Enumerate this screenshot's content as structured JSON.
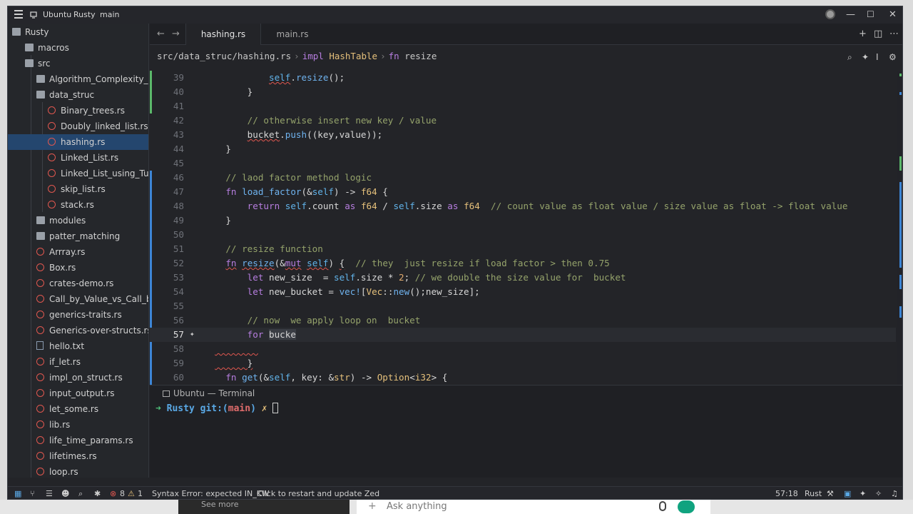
{
  "titlebar": {
    "menu_icon": "hamburger-icon",
    "host": "Ubuntu",
    "project": "Rusty",
    "branch": "main"
  },
  "sidebar": {
    "items": [
      {
        "label": "Rusty",
        "type": "folder",
        "depth": 0
      },
      {
        "label": "macros",
        "type": "folder",
        "depth": 1
      },
      {
        "label": "src",
        "type": "folder",
        "depth": 1
      },
      {
        "label": "Algorithm_Complexity_Sol",
        "type": "folder",
        "depth": 2
      },
      {
        "label": "data_struc",
        "type": "folder",
        "depth": 2
      },
      {
        "label": "Binary_trees.rs",
        "type": "rust",
        "depth": 3
      },
      {
        "label": "Doubly_linked_list.rs",
        "type": "rust",
        "depth": 3
      },
      {
        "label": "hashing.rs",
        "type": "rust",
        "depth": 3,
        "active": true
      },
      {
        "label": "Linked_List.rs",
        "type": "rust",
        "depth": 3
      },
      {
        "label": "Linked_List_using_Tup",
        "type": "rust",
        "depth": 3
      },
      {
        "label": "skip_list.rs",
        "type": "rust",
        "depth": 3
      },
      {
        "label": "stack.rs",
        "type": "rust",
        "depth": 3
      },
      {
        "label": "modules",
        "type": "folder",
        "depth": 2
      },
      {
        "label": "patter_matching",
        "type": "folder",
        "depth": 2
      },
      {
        "label": "Arrray.rs",
        "type": "rust",
        "depth": 2
      },
      {
        "label": "Box.rs",
        "type": "rust",
        "depth": 2
      },
      {
        "label": "crates-demo.rs",
        "type": "rust",
        "depth": 2
      },
      {
        "label": "Call_by_Value_vs_Call_by",
        "type": "rust",
        "depth": 2
      },
      {
        "label": "generics-traits.rs",
        "type": "rust",
        "depth": 2
      },
      {
        "label": "Generics-over-structs.rs",
        "type": "rust",
        "depth": 2
      },
      {
        "label": "hello.txt",
        "type": "text",
        "depth": 2
      },
      {
        "label": "if_let.rs",
        "type": "rust",
        "depth": 2
      },
      {
        "label": "impl_on_struct.rs",
        "type": "rust",
        "depth": 2
      },
      {
        "label": "input_output.rs",
        "type": "rust",
        "depth": 2
      },
      {
        "label": "let_some.rs",
        "type": "rust",
        "depth": 2
      },
      {
        "label": "lib.rs",
        "type": "rust",
        "depth": 2
      },
      {
        "label": "life_time_params.rs",
        "type": "rust",
        "depth": 2
      },
      {
        "label": "lifetimes.rs",
        "type": "rust",
        "depth": 2
      },
      {
        "label": "loop.rs",
        "type": "rust",
        "depth": 2
      }
    ]
  },
  "tabs": [
    {
      "label": "hashing.rs",
      "active": true
    },
    {
      "label": "main.rs",
      "active": false
    }
  ],
  "breadcrumb": {
    "path": "src/data_struc/hashing.rs",
    "impl_kw": "impl",
    "impl_type": "HashTable",
    "fn_kw": "fn",
    "fn_name": "resize"
  },
  "editor": {
    "current_line": 57,
    "line_numbers": [
      "39",
      "40",
      "41",
      "42",
      "43",
      "44",
      "45",
      "46",
      "47",
      "48",
      "49",
      "50",
      "51",
      "52",
      "53",
      "54",
      "55",
      "56",
      "57",
      "58",
      "59",
      "60"
    ]
  },
  "terminal": {
    "tab_label": "Ubuntu — Terminal",
    "arrow": "➜",
    "dir": "Rusty",
    "git_label": "git:(",
    "branch": "main",
    "git_close": ")",
    "dirty_mark": "✗"
  },
  "statusbar": {
    "errors": "8",
    "warnings": "1",
    "message": "Syntax Error: expected IN_KW",
    "update": "Click to restart and update Zed",
    "cursor_pos": "57:18",
    "language": "Rust"
  },
  "desktop": {
    "see_more": "See more",
    "ask_placeholder": "Ask anything"
  },
  "colors": {
    "accent": "#24466e",
    "error": "#e0574f",
    "terminal_arrow": "#4fc17a",
    "terminal_dir": "#5aa9e6",
    "terminal_branch": "#e06c6c",
    "terminal_dirty": "#e5c07b"
  }
}
